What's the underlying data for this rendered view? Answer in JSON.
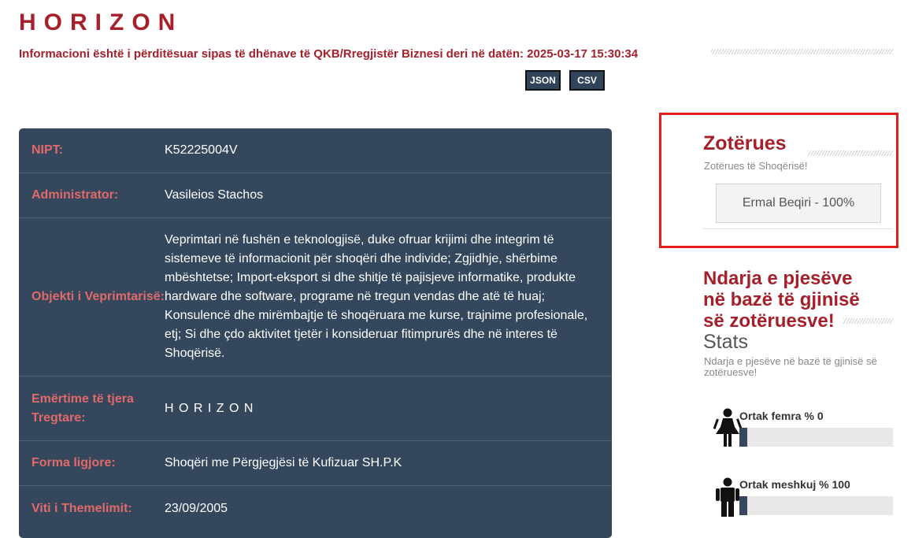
{
  "header": {
    "title": "HORIZON",
    "subtitle": "Informacioni është i përditësuar sipas të dhënave të QKB/Rregjistër Biznesi deri në datën: 2025-03-17 15:30:34",
    "json_label": "JSON",
    "csv_label": "CSV"
  },
  "details": [
    {
      "label": "NIPT:",
      "value": "K52225004V"
    },
    {
      "label": "Administrator:",
      "value": "Vasileios Stachos"
    },
    {
      "label": "Objekti i Veprimtarisë:",
      "value": "Veprimtari në fushën e teknologjisë, duke ofruar krijimi dhe integrim të sistemeve të informacionit për shoqëri dhe individe; Zgjidhje, shërbime mbështetse; Import-eksport si dhe shitje të pajisjeve informatike, produkte hardware dhe software, programe në tregun vendas dhe atë të huaj; Konsulencë dhe mirëmbajtje të shoqëruara me kurse, trajnime profesionale, etj; Si dhe çdo aktivitet tjetër i konsideruar fitimprurës dhe në interes të Shoqërisë."
    },
    {
      "label": "Emërtime të tjera Tregtare:",
      "value": "H O R I Z O N"
    },
    {
      "label": "Forma ligjore:",
      "value": "Shoqëri me Përgjegjësi të Kufizuar SH.P.K"
    },
    {
      "label": "Viti i Themelimit:",
      "value": "23/09/2005"
    }
  ],
  "owners": {
    "title": "Zotërues",
    "subtitle": "Zotërues të Shoqërisë!",
    "items": [
      "Ermal Beqiri - 100%"
    ]
  },
  "stats": {
    "title": "Ndarja e pjesëve në bazë të gjinisë së zotëruesve!",
    "word": "Stats",
    "subtitle": "Ndarja e pjesëve në bazë të gjinisë së zotëruesve!",
    "female": {
      "label": "Ortak femra % 0",
      "percent": 0
    },
    "male": {
      "label": "Ortak meshkuj % 100",
      "percent": 100
    }
  },
  "colors": {
    "accent": "#a5202a",
    "panel": "#34475c",
    "highlight_border": "#e21b1b"
  }
}
